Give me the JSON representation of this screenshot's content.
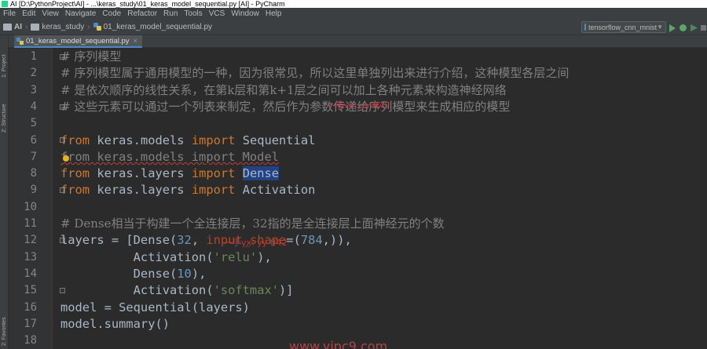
{
  "window": {
    "title": "AI [D:\\PythonProject\\AI] - ...\\keras_study\\01_keras_model_sequential.py [AI] - PyCharm"
  },
  "menu": [
    "File",
    "Edit",
    "View",
    "Navigate",
    "Code",
    "Refactor",
    "Run",
    "Tools",
    "VCS",
    "Window",
    "Help"
  ],
  "breadcrumb": {
    "project": "AI",
    "folder": "keras_study",
    "file": "01_keras_model_sequential.py"
  },
  "run_config": {
    "name": "tensorflow_cnn_mnist"
  },
  "sidebar": {
    "project_tab": "1: Project",
    "structure_tab": "Z: Structure",
    "favorites_tab": "2: Favorites"
  },
  "editor_tab": {
    "label": "01_keras_model_sequential.py"
  },
  "line_numbers": [
    "1",
    "2",
    "3",
    "4",
    "5",
    "6",
    "7",
    "8",
    "9",
    "10",
    "11",
    "12",
    "13",
    "14",
    "15",
    "16",
    "17",
    "18"
  ],
  "code": {
    "l1": "# 序列模型",
    "l2": "# 序列模型属于通用模型的一种，因为很常见，所以这里单独列出来进行介绍，这种模型各层之间",
    "l3": "# 是依次顺序的线性关系，在第k层和第k+1层之间可以加上各种元素来构造神经网络",
    "l4": "# 这些元素可以通过一个列表来制定，然后作为参数传递给序列模型来生成相应的模型",
    "l6_kw1": "from",
    "l6_mod": " keras.models ",
    "l6_kw2": "import",
    "l6_name": " Sequential",
    "l7_text": "from keras.models import Model",
    "l8_kw1": "from",
    "l8_mod": " keras.layers ",
    "l8_kw2": "import",
    "l8_sp": " ",
    "l8_name": "Dense",
    "l9_kw1": "from",
    "l9_mod": " keras.layers ",
    "l9_kw2": "import",
    "l9_name": " Activation",
    "l11": "# Dense相当于构建一个全连接层，32指的是全连接层上面神经元的个数",
    "l12_a": "layers = [Dense(",
    "l12_num": "32",
    "l12_b": ", ",
    "l12_kw": "input_shape",
    "l12_c": "=(",
    "l12_num2": "784",
    "l12_d": ",)),",
    "l13_a": "          Activation(",
    "l13_str": "'relu'",
    "l13_b": "),",
    "l14_a": "          Dense(",
    "l14_num": "10",
    "l14_b": "),",
    "l15_a": "          Activation(",
    "l15_str": "'softmax'",
    "l15_b": ")]",
    "l16": "model = Sequential(layers)",
    "l17": "model.summary()"
  },
  "watermarks": {
    "top": "一手vx: yy-ff42",
    "mid": "一手vx: yy-ff42",
    "bottom": "www.yipc9.com"
  },
  "colors": {
    "keyword": "#cc7832",
    "string": "#6a8759",
    "number": "#6897bb",
    "comment": "#808080",
    "selection": "#214283",
    "editor_bg": "#2b2b2b"
  }
}
